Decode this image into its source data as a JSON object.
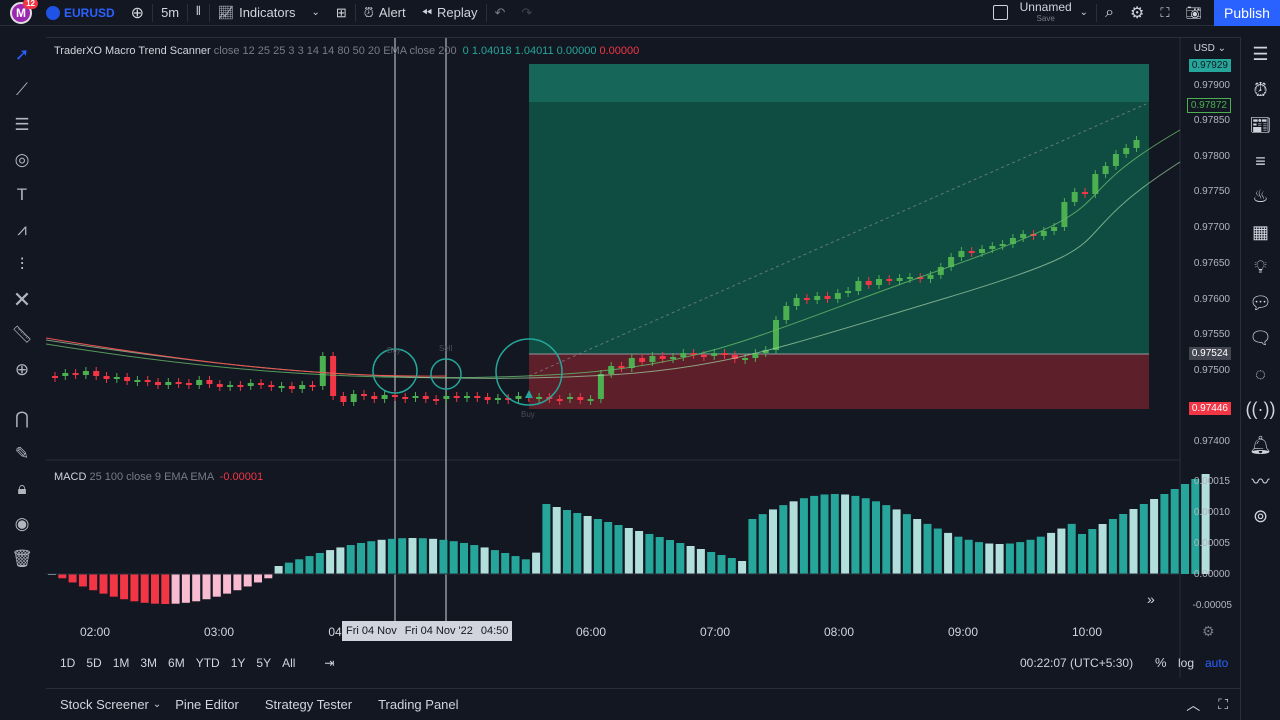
{
  "topbar": {
    "avatar_letter": "M",
    "avatar_badge": "12",
    "symbol": "EURUSD",
    "interval": "5m",
    "indicators": "Indicators",
    "alert": "Alert",
    "replay": "Replay",
    "layout_name": "Unnamed",
    "layout_save": "Save",
    "publish": "Publish"
  },
  "chart": {
    "currency": "USD",
    "main_legend": {
      "name": "TraderXO Macro Trend Scanner",
      "params": "close 12 25 25 3 3 14 14 80 50 20 EMA close 200",
      "v1": "0",
      "v2": "1.04018",
      "v3": "1.04011",
      "v4": "0.00000",
      "v5": "0.00000"
    },
    "macd_legend": {
      "name": "MACD",
      "params": "25 100 close 9 EMA EMA",
      "value": "-0.00001"
    },
    "price_axis": [
      "0.97900",
      "0.97850",
      "0.97800",
      "0.97750",
      "0.97700",
      "0.97650",
      "0.97600",
      "0.97550",
      "0.97500",
      "0.97400"
    ],
    "price_tags": {
      "top": "0.97929",
      "current": "0.97872",
      "entry": "0.97524",
      "stop": "0.97446"
    },
    "macd_axis": [
      "0.00015",
      "0.00010",
      "0.00005",
      "0.00000",
      "-0.00005"
    ],
    "time_axis": [
      "02:00",
      "03:00",
      "04",
      "06:00",
      "07:00",
      "08:00",
      "09:00",
      "10:00"
    ],
    "crosshair_labels": [
      "Fri 04 Nov",
      "Fri 04 Nov '22",
      "04:50"
    ],
    "signal_labels": [
      "Buy",
      "Sell",
      "Buy"
    ],
    "candle_colors": {
      "up": "#4caf50",
      "down": "#f23645"
    }
  },
  "bottombar": {
    "ranges": [
      "1D",
      "5D",
      "1M",
      "3M",
      "6M",
      "YTD",
      "1Y",
      "5Y",
      "All"
    ],
    "clock": "00:22:07 (UTC+5:30)",
    "percent": "%",
    "log": "log",
    "auto": "auto"
  },
  "footer": {
    "tabs": [
      "Stock Screener",
      "Pine Editor",
      "Strategy Tester",
      "Trading Panel"
    ]
  }
}
